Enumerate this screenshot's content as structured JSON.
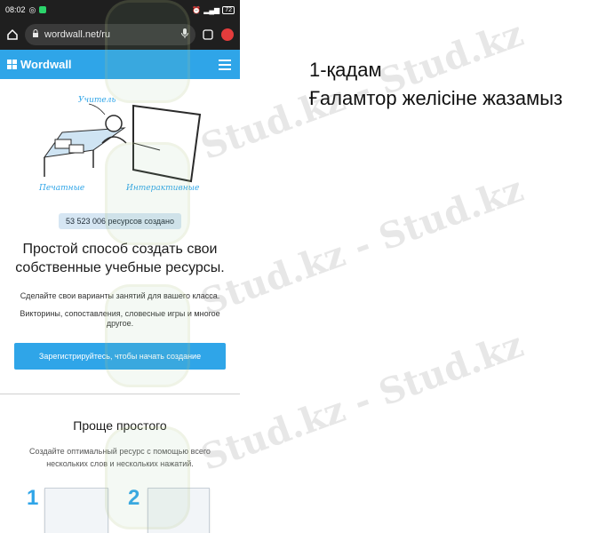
{
  "statusbar": {
    "time": "08:02",
    "battery": "72"
  },
  "browser": {
    "url": "wordwall.net/ru"
  },
  "site": {
    "logo_text": "Wordwall"
  },
  "hero": {
    "label_teacher": "Учитель",
    "label_print": "Печатные",
    "label_interactive": "Интерактивные"
  },
  "main": {
    "counter": "53 523 006 ресурсов создано",
    "headline": "Простой способ создать свои собственные учебные ресурсы.",
    "desc1": "Сделайте свои варианты занятий для вашего класса.",
    "desc2": "Викторины, сопоставления, словесные игры и многое другое.",
    "cta": "Зарегистрируйтесь, чтобы начать создание"
  },
  "section2": {
    "title": "Проще простого",
    "desc": "Создайте оптимальный ресурс с помощью всего нескольких слов и нескольких нажатий.",
    "step1": "1",
    "step2": "2"
  },
  "caption": {
    "line1": "1-қадам",
    "line2": "Ғаламтор желісіне жазамыз"
  },
  "watermark": {
    "text": "Stud.kz - Stud.kz"
  },
  "colors": {
    "brand_blue": "#2fa5e8",
    "statusbar": "#1f1f1f"
  }
}
